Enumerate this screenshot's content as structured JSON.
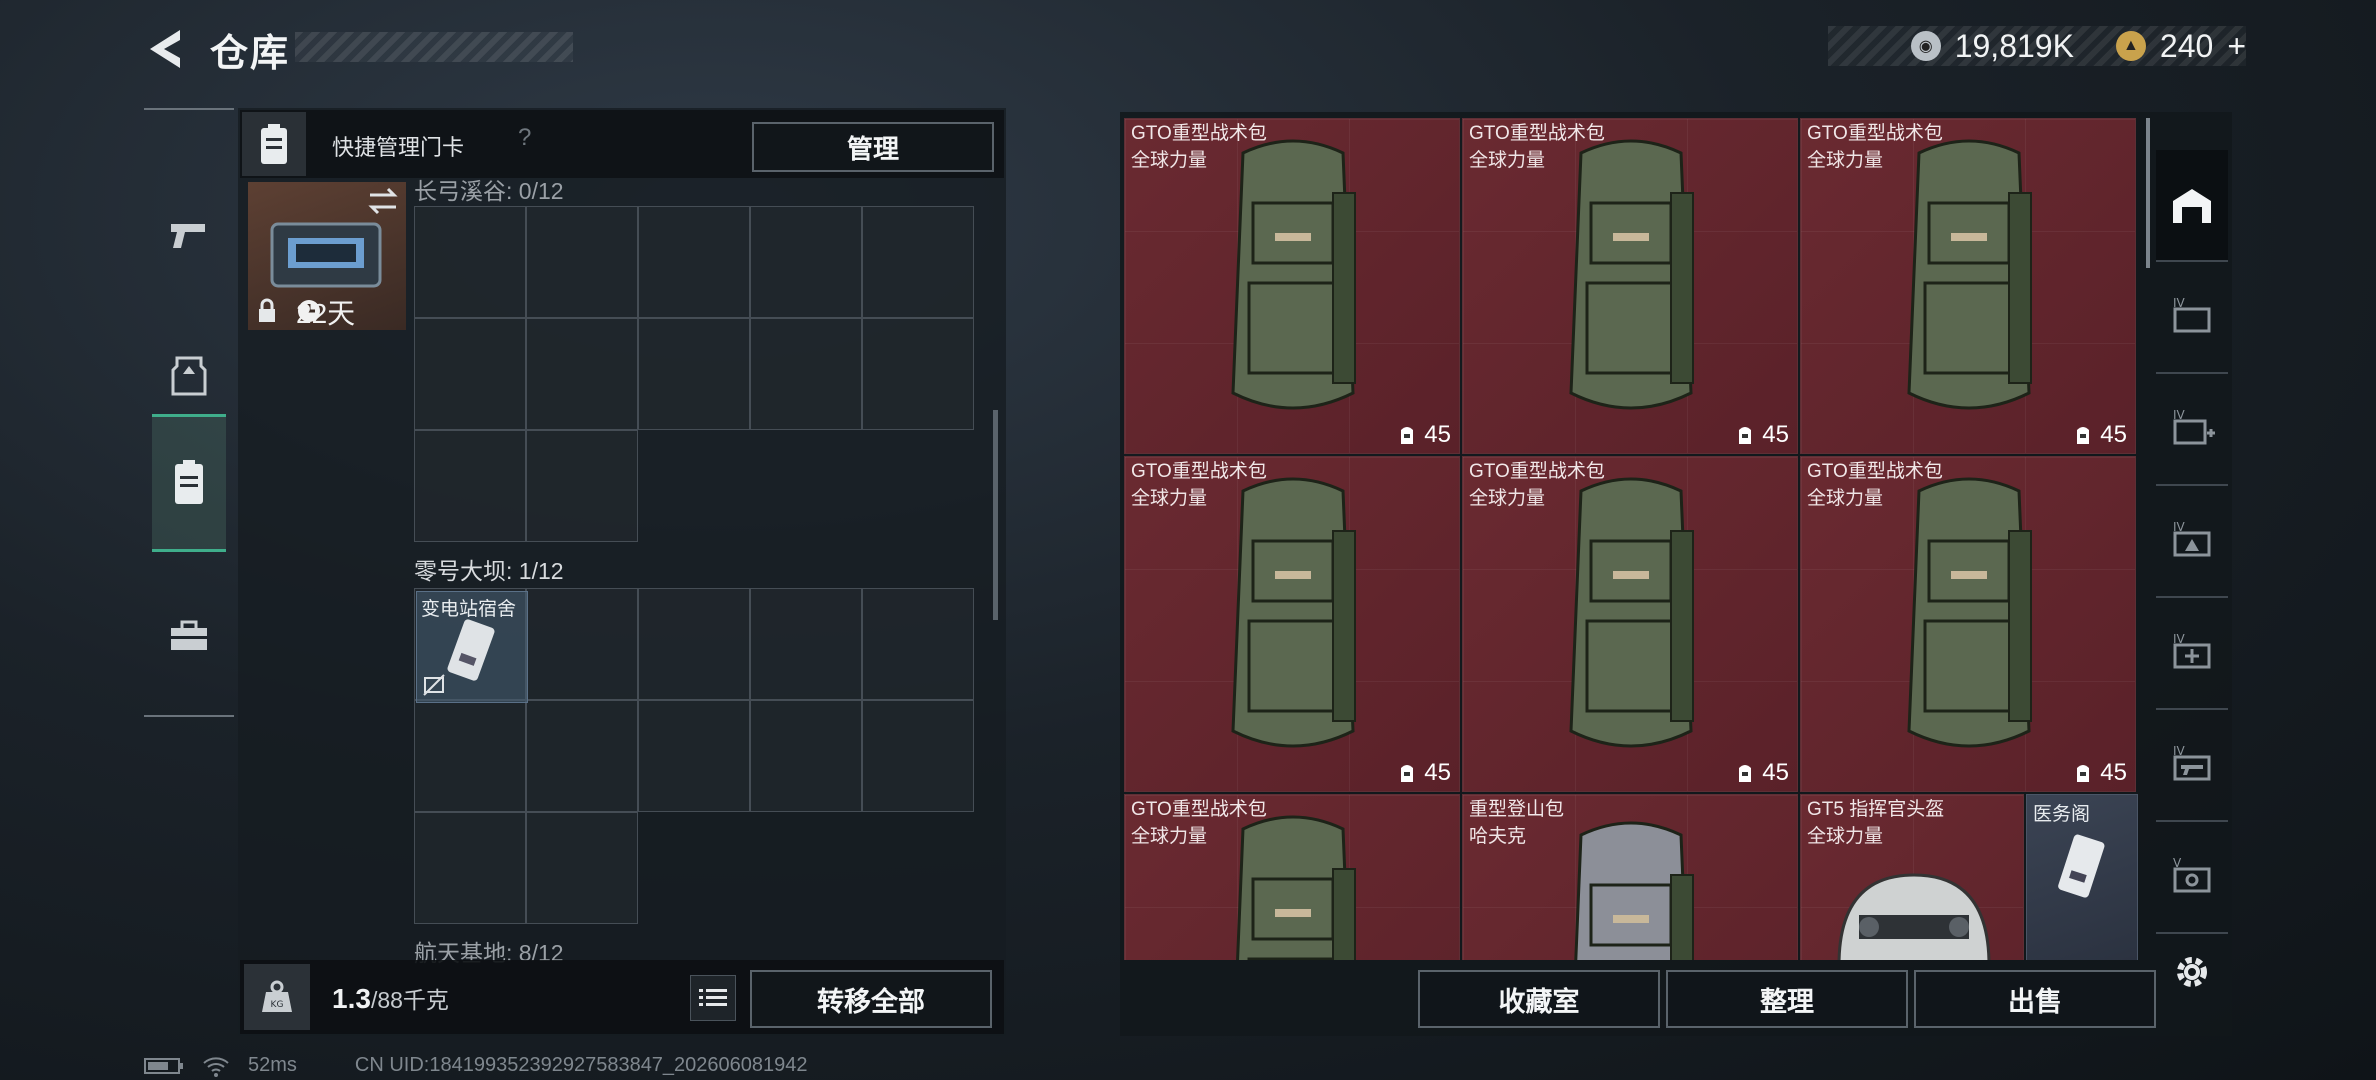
{
  "header": {
    "title": "仓库"
  },
  "currency": {
    "silver_value": "19,819K",
    "gold_value": "240",
    "add_symbol": "+"
  },
  "left_rail": {
    "items": [
      {
        "name": "weapons"
      },
      {
        "name": "gear"
      },
      {
        "name": "keycards",
        "active": true
      },
      {
        "name": "toolbox"
      }
    ]
  },
  "keycard_panel": {
    "header_label": "快捷管理门卡",
    "help_symbol": "?",
    "manage_label": "管理",
    "card_timer": "22天",
    "sections": [
      {
        "label": "长弓溪谷: 0/12"
      },
      {
        "label": "零号大坝: 1/12",
        "items": [
          {
            "name": "变电站宿舍"
          }
        ]
      },
      {
        "label": "航天基地: 8/12"
      }
    ]
  },
  "weight": {
    "current": "1.3",
    "max": "/88千克"
  },
  "buttons": {
    "transfer_all": "转移全部",
    "collection": "收藏室",
    "organize": "整理",
    "sell": "出售"
  },
  "inventory": {
    "items": [
      {
        "name": "GTO重型战术包",
        "maker": "全球力量",
        "capacity": "45"
      },
      {
        "name": "GTO重型战术包",
        "maker": "全球力量",
        "capacity": "45"
      },
      {
        "name": "GTO重型战术包",
        "maker": "全球力量",
        "capacity": "45"
      },
      {
        "name": "GTO重型战术包",
        "maker": "全球力量",
        "capacity": "45"
      },
      {
        "name": "GTO重型战术包",
        "maker": "全球力量",
        "capacity": "45"
      },
      {
        "name": "GTO重型战术包",
        "maker": "全球力量",
        "capacity": "45"
      },
      {
        "name": "GTO重型战术包",
        "maker": "全球力量"
      },
      {
        "name": "重型登山包",
        "maker": "哈夫克"
      },
      {
        "name": "GT5 指挥官头盔",
        "maker": "全球力量"
      },
      {
        "name": "医务阁"
      }
    ]
  },
  "status_bar": {
    "ping": "52ms",
    "uid": "CN UID:18419935239292758384​7_202606081942"
  },
  "colors": {
    "accent_green": "#3fae8b",
    "item_bg": "#6a2a31"
  }
}
